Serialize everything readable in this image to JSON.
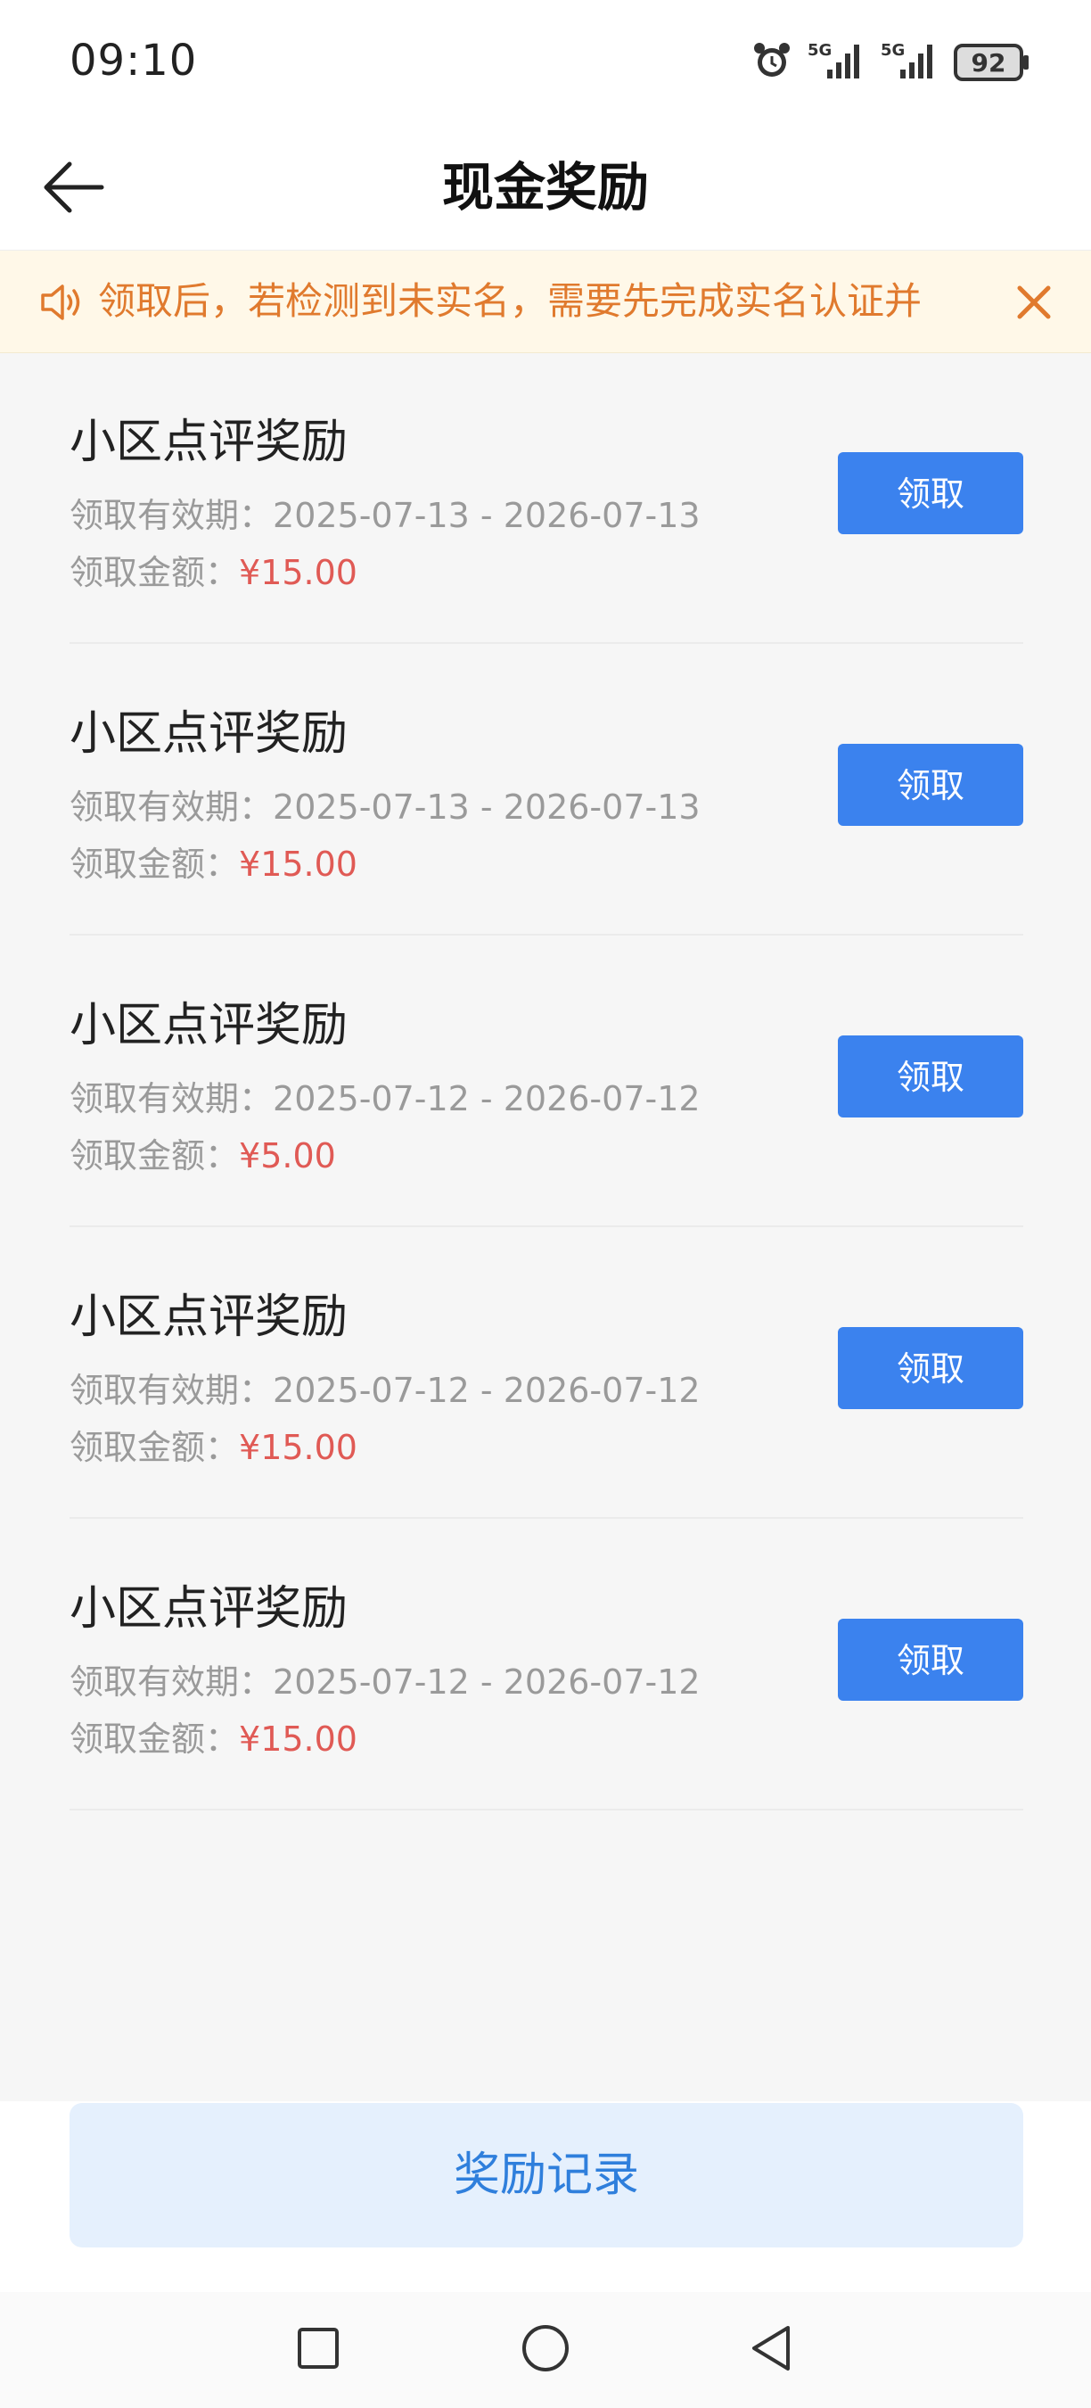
{
  "status_bar": {
    "time": "09:10",
    "signal1_label": "5G",
    "signal2_label": "5G",
    "battery": "92"
  },
  "header": {
    "title": "现金奖励"
  },
  "notice": {
    "text": "领取后，若检测到未实名，需要先完成实名认证并"
  },
  "rewards": [
    {
      "title": "小区点评奖励",
      "validity_label": "领取有效期：",
      "validity": "2025-07-13 - 2026-07-13",
      "amount_label": "领取金额：",
      "amount": "¥15.00",
      "button": "领取"
    },
    {
      "title": "小区点评奖励",
      "validity_label": "领取有效期：",
      "validity": "2025-07-13 - 2026-07-13",
      "amount_label": "领取金额：",
      "amount": "¥15.00",
      "button": "领取"
    },
    {
      "title": "小区点评奖励",
      "validity_label": "领取有效期：",
      "validity": "2025-07-12 - 2026-07-12",
      "amount_label": "领取金额：",
      "amount": "¥5.00",
      "button": "领取"
    },
    {
      "title": "小区点评奖励",
      "validity_label": "领取有效期：",
      "validity": "2025-07-12 - 2026-07-12",
      "amount_label": "领取金额：",
      "amount": "¥15.00",
      "button": "领取"
    },
    {
      "title": "小区点评奖励",
      "validity_label": "领取有效期：",
      "validity": "2025-07-12 - 2026-07-12",
      "amount_label": "领取金额：",
      "amount": "¥15.00",
      "button": "领取"
    }
  ],
  "footer": {
    "records_button": "奖励记录"
  },
  "colors": {
    "accent": "#3b82ee",
    "amount": "#e05a55",
    "notice": "#e07a2e"
  }
}
